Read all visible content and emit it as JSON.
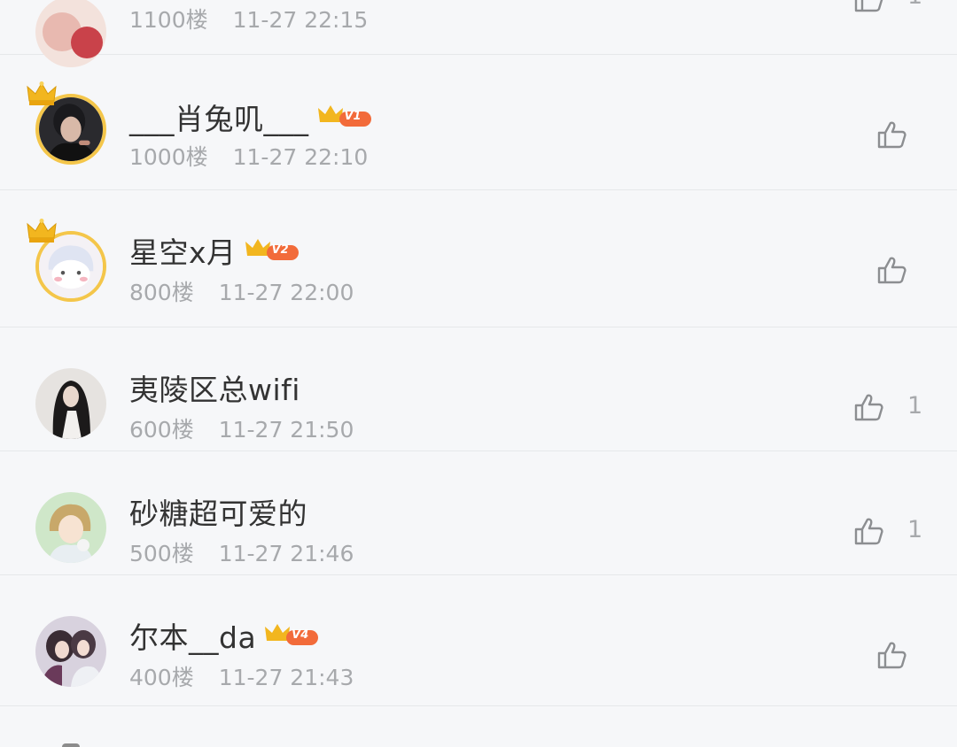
{
  "comments": [
    {
      "name": "",
      "floor": "1100楼",
      "time": "11-27 22:15",
      "likes": "1",
      "vip": "",
      "has_crown": false
    },
    {
      "name": "___肖兔叽___",
      "floor": "1000楼",
      "time": "11-27 22:10",
      "likes": "",
      "vip": "V1",
      "has_crown": true
    },
    {
      "name": "星空x月",
      "floor": "800楼",
      "time": "11-27 22:00",
      "likes": "",
      "vip": "V2",
      "has_crown": true
    },
    {
      "name": "夷陵区总wifi",
      "floor": "600楼",
      "time": "11-27 21:50",
      "likes": "1",
      "vip": "",
      "has_crown": false
    },
    {
      "name": "砂糖超可爱的",
      "floor": "500楼",
      "time": "11-27 21:46",
      "likes": "1",
      "vip": "",
      "has_crown": false
    },
    {
      "name": "尔本__da",
      "floor": "400楼",
      "time": "11-27 21:43",
      "likes": "",
      "vip": "V4",
      "has_crown": false
    }
  ],
  "icons": {
    "like": "thumbs-up-icon",
    "crown": "crown-icon",
    "vip_badge": "vip-badge-icon"
  },
  "colors": {
    "background": "#f6f7f9",
    "username": "#333333",
    "meta": "#a7a9ac",
    "divider": "#e6e8ea",
    "gold": "#f4c64a",
    "vip_badge": "#f26b3a"
  }
}
